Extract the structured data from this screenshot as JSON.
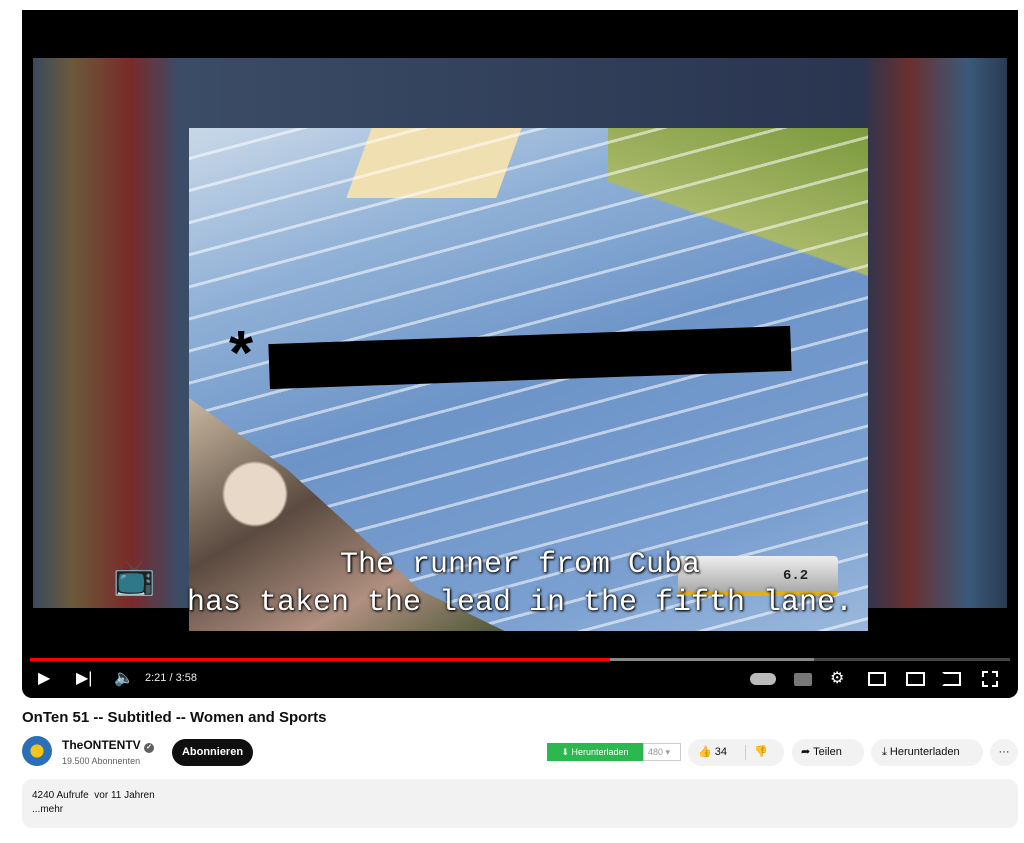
{
  "video": {
    "subtitle_line1": "The runner from Cuba",
    "subtitle_line2": "has taken the lead in the fifth lane.",
    "scoreboard": "6.2",
    "progress_fraction": 0.592,
    "buffered_fraction": 0.8
  },
  "controls": {
    "time": "2:21 / 3:58",
    "icons": [
      "play-icon",
      "next-icon",
      "volume-icon",
      "autoplay-toggle-icon",
      "subtitles-icon",
      "settings-icon",
      "miniplayer-icon",
      "theater-icon",
      "cast-icon",
      "fullscreen-icon"
    ]
  },
  "title": "OnTen 51 -- Subtitled -- Women and Sports",
  "channel": {
    "name": "TheONTENTV",
    "verified": true,
    "subscribers": "19.500 Abonnenten",
    "subscribe_label": "Abonnieren"
  },
  "actions": {
    "download_ext_label": "Herunterladen",
    "quality": "480",
    "likes": "34",
    "share_label": "Teilen",
    "download_label": "Herunterladen",
    "more": "···"
  },
  "description": {
    "stats": "4240 Aufrufe  vor 11 Jahren",
    "more": "...mehr"
  },
  "colors": {
    "progress": "#ff0000",
    "download_ext": "#2bb84f"
  }
}
